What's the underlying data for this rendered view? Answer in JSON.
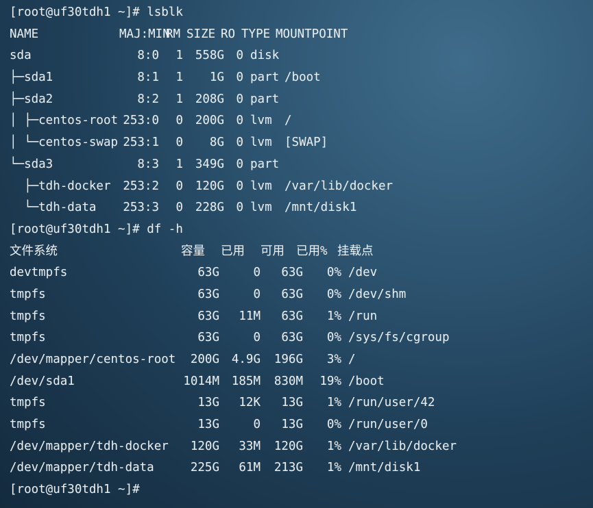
{
  "terminal": {
    "prompt": "[root@uf30tdh1 ~]#",
    "commands": {
      "lsblk": "lsblk",
      "df": "df -h"
    },
    "lsblk": {
      "headers": [
        "NAME",
        "MAJ:MIN",
        "RM",
        "SIZE",
        "RO",
        "TYPE",
        "MOUNTPOINT"
      ],
      "rows": [
        [
          "sda",
          "8:0",
          "1",
          "558G",
          "0",
          "disk",
          ""
        ],
        [
          "├─sda1",
          "8:1",
          "1",
          "1G",
          "0",
          "part",
          "/boot"
        ],
        [
          "├─sda2",
          "8:2",
          "1",
          "208G",
          "0",
          "part",
          ""
        ],
        [
          "│ ├─centos-root",
          "253:0",
          "0",
          "200G",
          "0",
          "lvm",
          "/"
        ],
        [
          "│ └─centos-swap",
          "253:1",
          "0",
          "8G",
          "0",
          "lvm",
          "[SWAP]"
        ],
        [
          "└─sda3",
          "8:3",
          "1",
          "349G",
          "0",
          "part",
          ""
        ],
        [
          "  ├─tdh-docker",
          "253:2",
          "0",
          "120G",
          "0",
          "lvm",
          "/var/lib/docker"
        ],
        [
          "  └─tdh-data",
          "253:3",
          "0",
          "228G",
          "0",
          "lvm",
          "/mnt/disk1"
        ]
      ]
    },
    "df": {
      "headers": [
        "文件系统",
        "容量",
        "已用",
        "可用",
        "已用%",
        "挂载点"
      ],
      "rows": [
        [
          "devtmpfs",
          "63G",
          "0",
          "63G",
          "0%",
          "/dev"
        ],
        [
          "tmpfs",
          "63G",
          "0",
          "63G",
          "0%",
          "/dev/shm"
        ],
        [
          "tmpfs",
          "63G",
          "11M",
          "63G",
          "1%",
          "/run"
        ],
        [
          "tmpfs",
          "63G",
          "0",
          "63G",
          "0%",
          "/sys/fs/cgroup"
        ],
        [
          "/dev/mapper/centos-root",
          "200G",
          "4.9G",
          "196G",
          "3%",
          "/"
        ],
        [
          "/dev/sda1",
          "1014M",
          "185M",
          "830M",
          "19%",
          "/boot"
        ],
        [
          "tmpfs",
          "13G",
          "12K",
          "13G",
          "1%",
          "/run/user/42"
        ],
        [
          "tmpfs",
          "13G",
          "0",
          "13G",
          "0%",
          "/run/user/0"
        ],
        [
          "/dev/mapper/tdh-docker",
          "120G",
          "33M",
          "120G",
          "1%",
          "/var/lib/docker"
        ],
        [
          "/dev/mapper/tdh-data",
          "225G",
          "61M",
          "213G",
          "1%",
          "/mnt/disk1"
        ]
      ]
    }
  }
}
